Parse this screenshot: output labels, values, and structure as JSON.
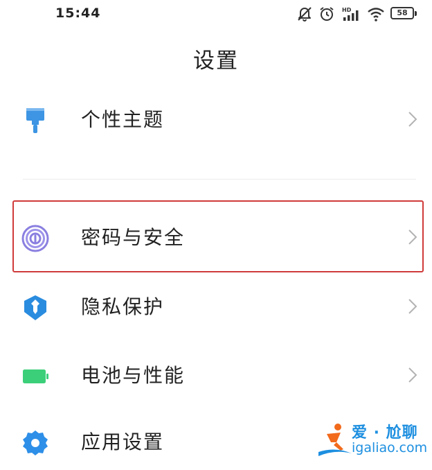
{
  "status_bar": {
    "time": "15:44",
    "icons": [
      "mute-icon",
      "alarm-icon",
      "hd-signal-icon",
      "wifi-icon",
      "battery-icon"
    ],
    "signal_label": "HD",
    "battery_level": "58"
  },
  "page": {
    "title": "设置"
  },
  "settings": {
    "items": [
      {
        "label": "个性主题",
        "icon": "theme-brush-icon",
        "icon_color": "#3d95e3"
      },
      {
        "label": "密码与安全",
        "icon": "fingerprint-icon",
        "icon_color": "#8a7fe0",
        "highlighted": true
      },
      {
        "label": "隐私保护",
        "icon": "privacy-shield-icon",
        "icon_color": "#2a8cdf"
      },
      {
        "label": "电池与性能",
        "icon": "battery-icon",
        "icon_color": "#3ccf7a"
      },
      {
        "label": "应用设置",
        "icon": "gear-icon",
        "icon_color": "#2e8fe8"
      }
    ]
  },
  "watermark": {
    "title": "爱 · 尬聊",
    "domain": "igaliao.com",
    "color": "#1d8fe0",
    "accent": "#f26a1b"
  },
  "colors": {
    "highlight_border": "#d03a3a",
    "chevron": "#b3b3b3",
    "divider": "#ececec"
  }
}
